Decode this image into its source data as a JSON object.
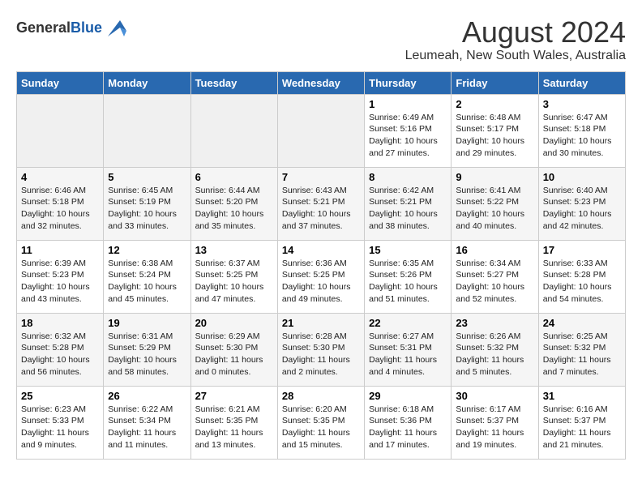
{
  "header": {
    "logo_general": "General",
    "logo_blue": "Blue",
    "month_year": "August 2024",
    "location": "Leumeah, New South Wales, Australia"
  },
  "days_of_week": [
    "Sunday",
    "Monday",
    "Tuesday",
    "Wednesday",
    "Thursday",
    "Friday",
    "Saturday"
  ],
  "weeks": [
    [
      {
        "num": "",
        "sunrise": "",
        "sunset": "",
        "daylight": "",
        "empty": true
      },
      {
        "num": "",
        "sunrise": "",
        "sunset": "",
        "daylight": "",
        "empty": true
      },
      {
        "num": "",
        "sunrise": "",
        "sunset": "",
        "daylight": "",
        "empty": true
      },
      {
        "num": "",
        "sunrise": "",
        "sunset": "",
        "daylight": "",
        "empty": true
      },
      {
        "num": "1",
        "sunrise": "Sunrise: 6:49 AM",
        "sunset": "Sunset: 5:16 PM",
        "daylight": "Daylight: 10 hours and 27 minutes."
      },
      {
        "num": "2",
        "sunrise": "Sunrise: 6:48 AM",
        "sunset": "Sunset: 5:17 PM",
        "daylight": "Daylight: 10 hours and 29 minutes."
      },
      {
        "num": "3",
        "sunrise": "Sunrise: 6:47 AM",
        "sunset": "Sunset: 5:18 PM",
        "daylight": "Daylight: 10 hours and 30 minutes."
      }
    ],
    [
      {
        "num": "4",
        "sunrise": "Sunrise: 6:46 AM",
        "sunset": "Sunset: 5:18 PM",
        "daylight": "Daylight: 10 hours and 32 minutes."
      },
      {
        "num": "5",
        "sunrise": "Sunrise: 6:45 AM",
        "sunset": "Sunset: 5:19 PM",
        "daylight": "Daylight: 10 hours and 33 minutes."
      },
      {
        "num": "6",
        "sunrise": "Sunrise: 6:44 AM",
        "sunset": "Sunset: 5:20 PM",
        "daylight": "Daylight: 10 hours and 35 minutes."
      },
      {
        "num": "7",
        "sunrise": "Sunrise: 6:43 AM",
        "sunset": "Sunset: 5:21 PM",
        "daylight": "Daylight: 10 hours and 37 minutes."
      },
      {
        "num": "8",
        "sunrise": "Sunrise: 6:42 AM",
        "sunset": "Sunset: 5:21 PM",
        "daylight": "Daylight: 10 hours and 38 minutes."
      },
      {
        "num": "9",
        "sunrise": "Sunrise: 6:41 AM",
        "sunset": "Sunset: 5:22 PM",
        "daylight": "Daylight: 10 hours and 40 minutes."
      },
      {
        "num": "10",
        "sunrise": "Sunrise: 6:40 AM",
        "sunset": "Sunset: 5:23 PM",
        "daylight": "Daylight: 10 hours and 42 minutes."
      }
    ],
    [
      {
        "num": "11",
        "sunrise": "Sunrise: 6:39 AM",
        "sunset": "Sunset: 5:23 PM",
        "daylight": "Daylight: 10 hours and 43 minutes."
      },
      {
        "num": "12",
        "sunrise": "Sunrise: 6:38 AM",
        "sunset": "Sunset: 5:24 PM",
        "daylight": "Daylight: 10 hours and 45 minutes."
      },
      {
        "num": "13",
        "sunrise": "Sunrise: 6:37 AM",
        "sunset": "Sunset: 5:25 PM",
        "daylight": "Daylight: 10 hours and 47 minutes."
      },
      {
        "num": "14",
        "sunrise": "Sunrise: 6:36 AM",
        "sunset": "Sunset: 5:25 PM",
        "daylight": "Daylight: 10 hours and 49 minutes."
      },
      {
        "num": "15",
        "sunrise": "Sunrise: 6:35 AM",
        "sunset": "Sunset: 5:26 PM",
        "daylight": "Daylight: 10 hours and 51 minutes."
      },
      {
        "num": "16",
        "sunrise": "Sunrise: 6:34 AM",
        "sunset": "Sunset: 5:27 PM",
        "daylight": "Daylight: 10 hours and 52 minutes."
      },
      {
        "num": "17",
        "sunrise": "Sunrise: 6:33 AM",
        "sunset": "Sunset: 5:28 PM",
        "daylight": "Daylight: 10 hours and 54 minutes."
      }
    ],
    [
      {
        "num": "18",
        "sunrise": "Sunrise: 6:32 AM",
        "sunset": "Sunset: 5:28 PM",
        "daylight": "Daylight: 10 hours and 56 minutes."
      },
      {
        "num": "19",
        "sunrise": "Sunrise: 6:31 AM",
        "sunset": "Sunset: 5:29 PM",
        "daylight": "Daylight: 10 hours and 58 minutes."
      },
      {
        "num": "20",
        "sunrise": "Sunrise: 6:29 AM",
        "sunset": "Sunset: 5:30 PM",
        "daylight": "Daylight: 11 hours and 0 minutes."
      },
      {
        "num": "21",
        "sunrise": "Sunrise: 6:28 AM",
        "sunset": "Sunset: 5:30 PM",
        "daylight": "Daylight: 11 hours and 2 minutes."
      },
      {
        "num": "22",
        "sunrise": "Sunrise: 6:27 AM",
        "sunset": "Sunset: 5:31 PM",
        "daylight": "Daylight: 11 hours and 4 minutes."
      },
      {
        "num": "23",
        "sunrise": "Sunrise: 6:26 AM",
        "sunset": "Sunset: 5:32 PM",
        "daylight": "Daylight: 11 hours and 5 minutes."
      },
      {
        "num": "24",
        "sunrise": "Sunrise: 6:25 AM",
        "sunset": "Sunset: 5:32 PM",
        "daylight": "Daylight: 11 hours and 7 minutes."
      }
    ],
    [
      {
        "num": "25",
        "sunrise": "Sunrise: 6:23 AM",
        "sunset": "Sunset: 5:33 PM",
        "daylight": "Daylight: 11 hours and 9 minutes."
      },
      {
        "num": "26",
        "sunrise": "Sunrise: 6:22 AM",
        "sunset": "Sunset: 5:34 PM",
        "daylight": "Daylight: 11 hours and 11 minutes."
      },
      {
        "num": "27",
        "sunrise": "Sunrise: 6:21 AM",
        "sunset": "Sunset: 5:35 PM",
        "daylight": "Daylight: 11 hours and 13 minutes."
      },
      {
        "num": "28",
        "sunrise": "Sunrise: 6:20 AM",
        "sunset": "Sunset: 5:35 PM",
        "daylight": "Daylight: 11 hours and 15 minutes."
      },
      {
        "num": "29",
        "sunrise": "Sunrise: 6:18 AM",
        "sunset": "Sunset: 5:36 PM",
        "daylight": "Daylight: 11 hours and 17 minutes."
      },
      {
        "num": "30",
        "sunrise": "Sunrise: 6:17 AM",
        "sunset": "Sunset: 5:37 PM",
        "daylight": "Daylight: 11 hours and 19 minutes."
      },
      {
        "num": "31",
        "sunrise": "Sunrise: 6:16 AM",
        "sunset": "Sunset: 5:37 PM",
        "daylight": "Daylight: 11 hours and 21 minutes."
      }
    ]
  ]
}
